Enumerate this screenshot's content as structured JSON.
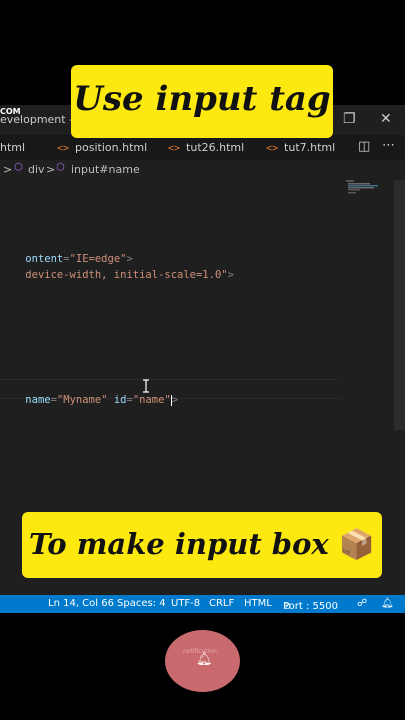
{
  "window": {
    "title": "evelopment - Vis",
    "logo_text": "COM"
  },
  "tabs": [
    {
      "label": "html",
      "icon": "html-file-icon"
    },
    {
      "label": "position.html",
      "icon": "html-file-icon"
    },
    {
      "label": "tut26.html",
      "icon": "html-file-icon"
    },
    {
      "label": "tut7.html",
      "icon": "html-file-icon"
    }
  ],
  "breadcrumb": {
    "items": [
      "div",
      "input#name"
    ],
    "separator": ">"
  },
  "code": {
    "line1": {
      "attr": "ontent",
      "eq": "=",
      "value": "\"IE=edge\"",
      "close": ">"
    },
    "line2": {
      "value": "device-width, initial-scale=1.0\"",
      "close": ">"
    },
    "line3": {
      "attr1": "name",
      "eq": "=",
      "value1": "\"Myname\"",
      "attr2": "id",
      "value2": "\"name\"",
      "close": ">"
    }
  },
  "statusbar": {
    "position": "Ln 14, Col 66",
    "spaces": "Spaces: 4",
    "encoding": "UTF-8",
    "eol": "CRLF",
    "language": "HTML",
    "port": "Port : 5500",
    "color": "#007acc"
  },
  "overlay": {
    "top_banner": "Use input tag",
    "bottom_banner": "To make input box",
    "banner_color": "#fde910",
    "bottom_emoji": "📦"
  },
  "bell_button": {
    "faint_label": "notification"
  }
}
